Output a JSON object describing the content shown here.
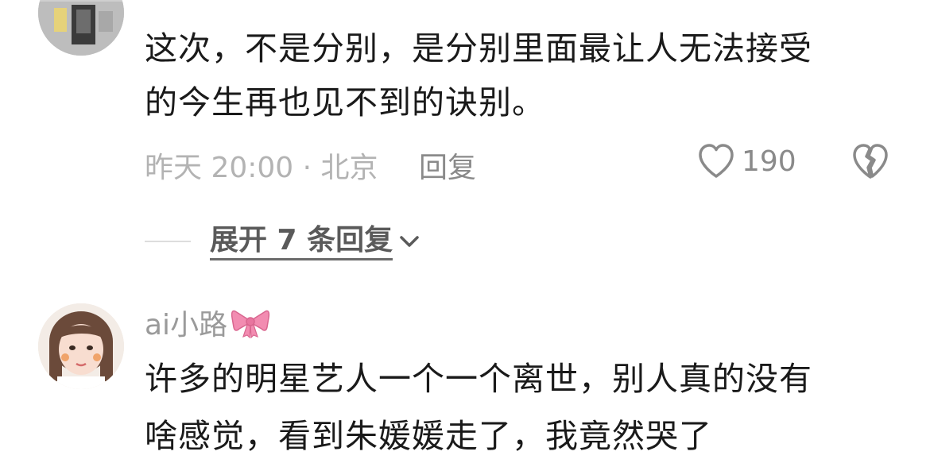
{
  "comments": [
    {
      "lines": [
        "这次，不是分别，是分别里面最让人无法接受",
        "的今生再也见不到的诀别。"
      ],
      "meta": {
        "time_location": "昨天 20:00 · 北京",
        "reply_label": "回复",
        "like_count": "190"
      },
      "expand": {
        "label": "展开 7 条回复"
      }
    },
    {
      "username": "ai小路",
      "lines": [
        "许多的明星艺人一个一个离世，别人真的没有",
        "啥感觉，看到朱媛媛走了，我竟然哭了"
      ]
    }
  ],
  "icons": {
    "like": "heart-outline-icon",
    "dislike": "broken-heart-icon",
    "expand": "chevron-down-icon",
    "decoration": "pink-bow-icon"
  },
  "colors": {
    "text_primary": "#1a1a1a",
    "text_secondary": "#8a8a8a",
    "text_muted": "#b3b3b3",
    "bow_pink": "#f28cb1"
  }
}
